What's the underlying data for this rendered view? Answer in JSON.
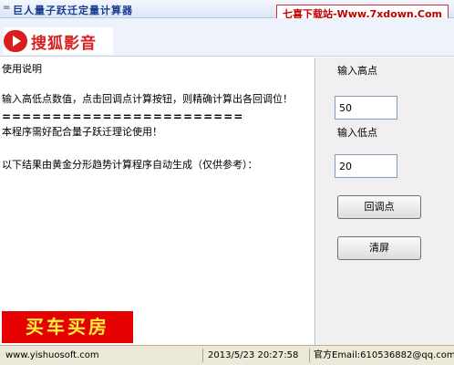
{
  "window": {
    "title_icon": "=",
    "title": "巨人量子跃迁定量计算器",
    "watermark": "七喜下载站-Www.7xdown.Com"
  },
  "banner": {
    "logo_text": "搜狐影音"
  },
  "main": {
    "section_title": "使用说明",
    "description_lines": [
      "输入高低点数值，点击回调点计算按钮，则精确计算出各回调位！",
      "本程序需好配合量子跃迁理论使用！",
      "以下结果由黄金分形趋势计算程序自动生成（仅供参考）："
    ],
    "separator": "========================",
    "ad_text": "买车买房"
  },
  "side": {
    "high_label": "输入高点",
    "high_value": "50",
    "low_label": "输入低点",
    "low_value": "20",
    "calc_button": "回调点",
    "clear_button": "清屏"
  },
  "status": {
    "website": "www.yishuosoft.com",
    "datetime": "2013/5/23 20:27:58",
    "email": "官方Email:610536882@qq.com"
  }
}
